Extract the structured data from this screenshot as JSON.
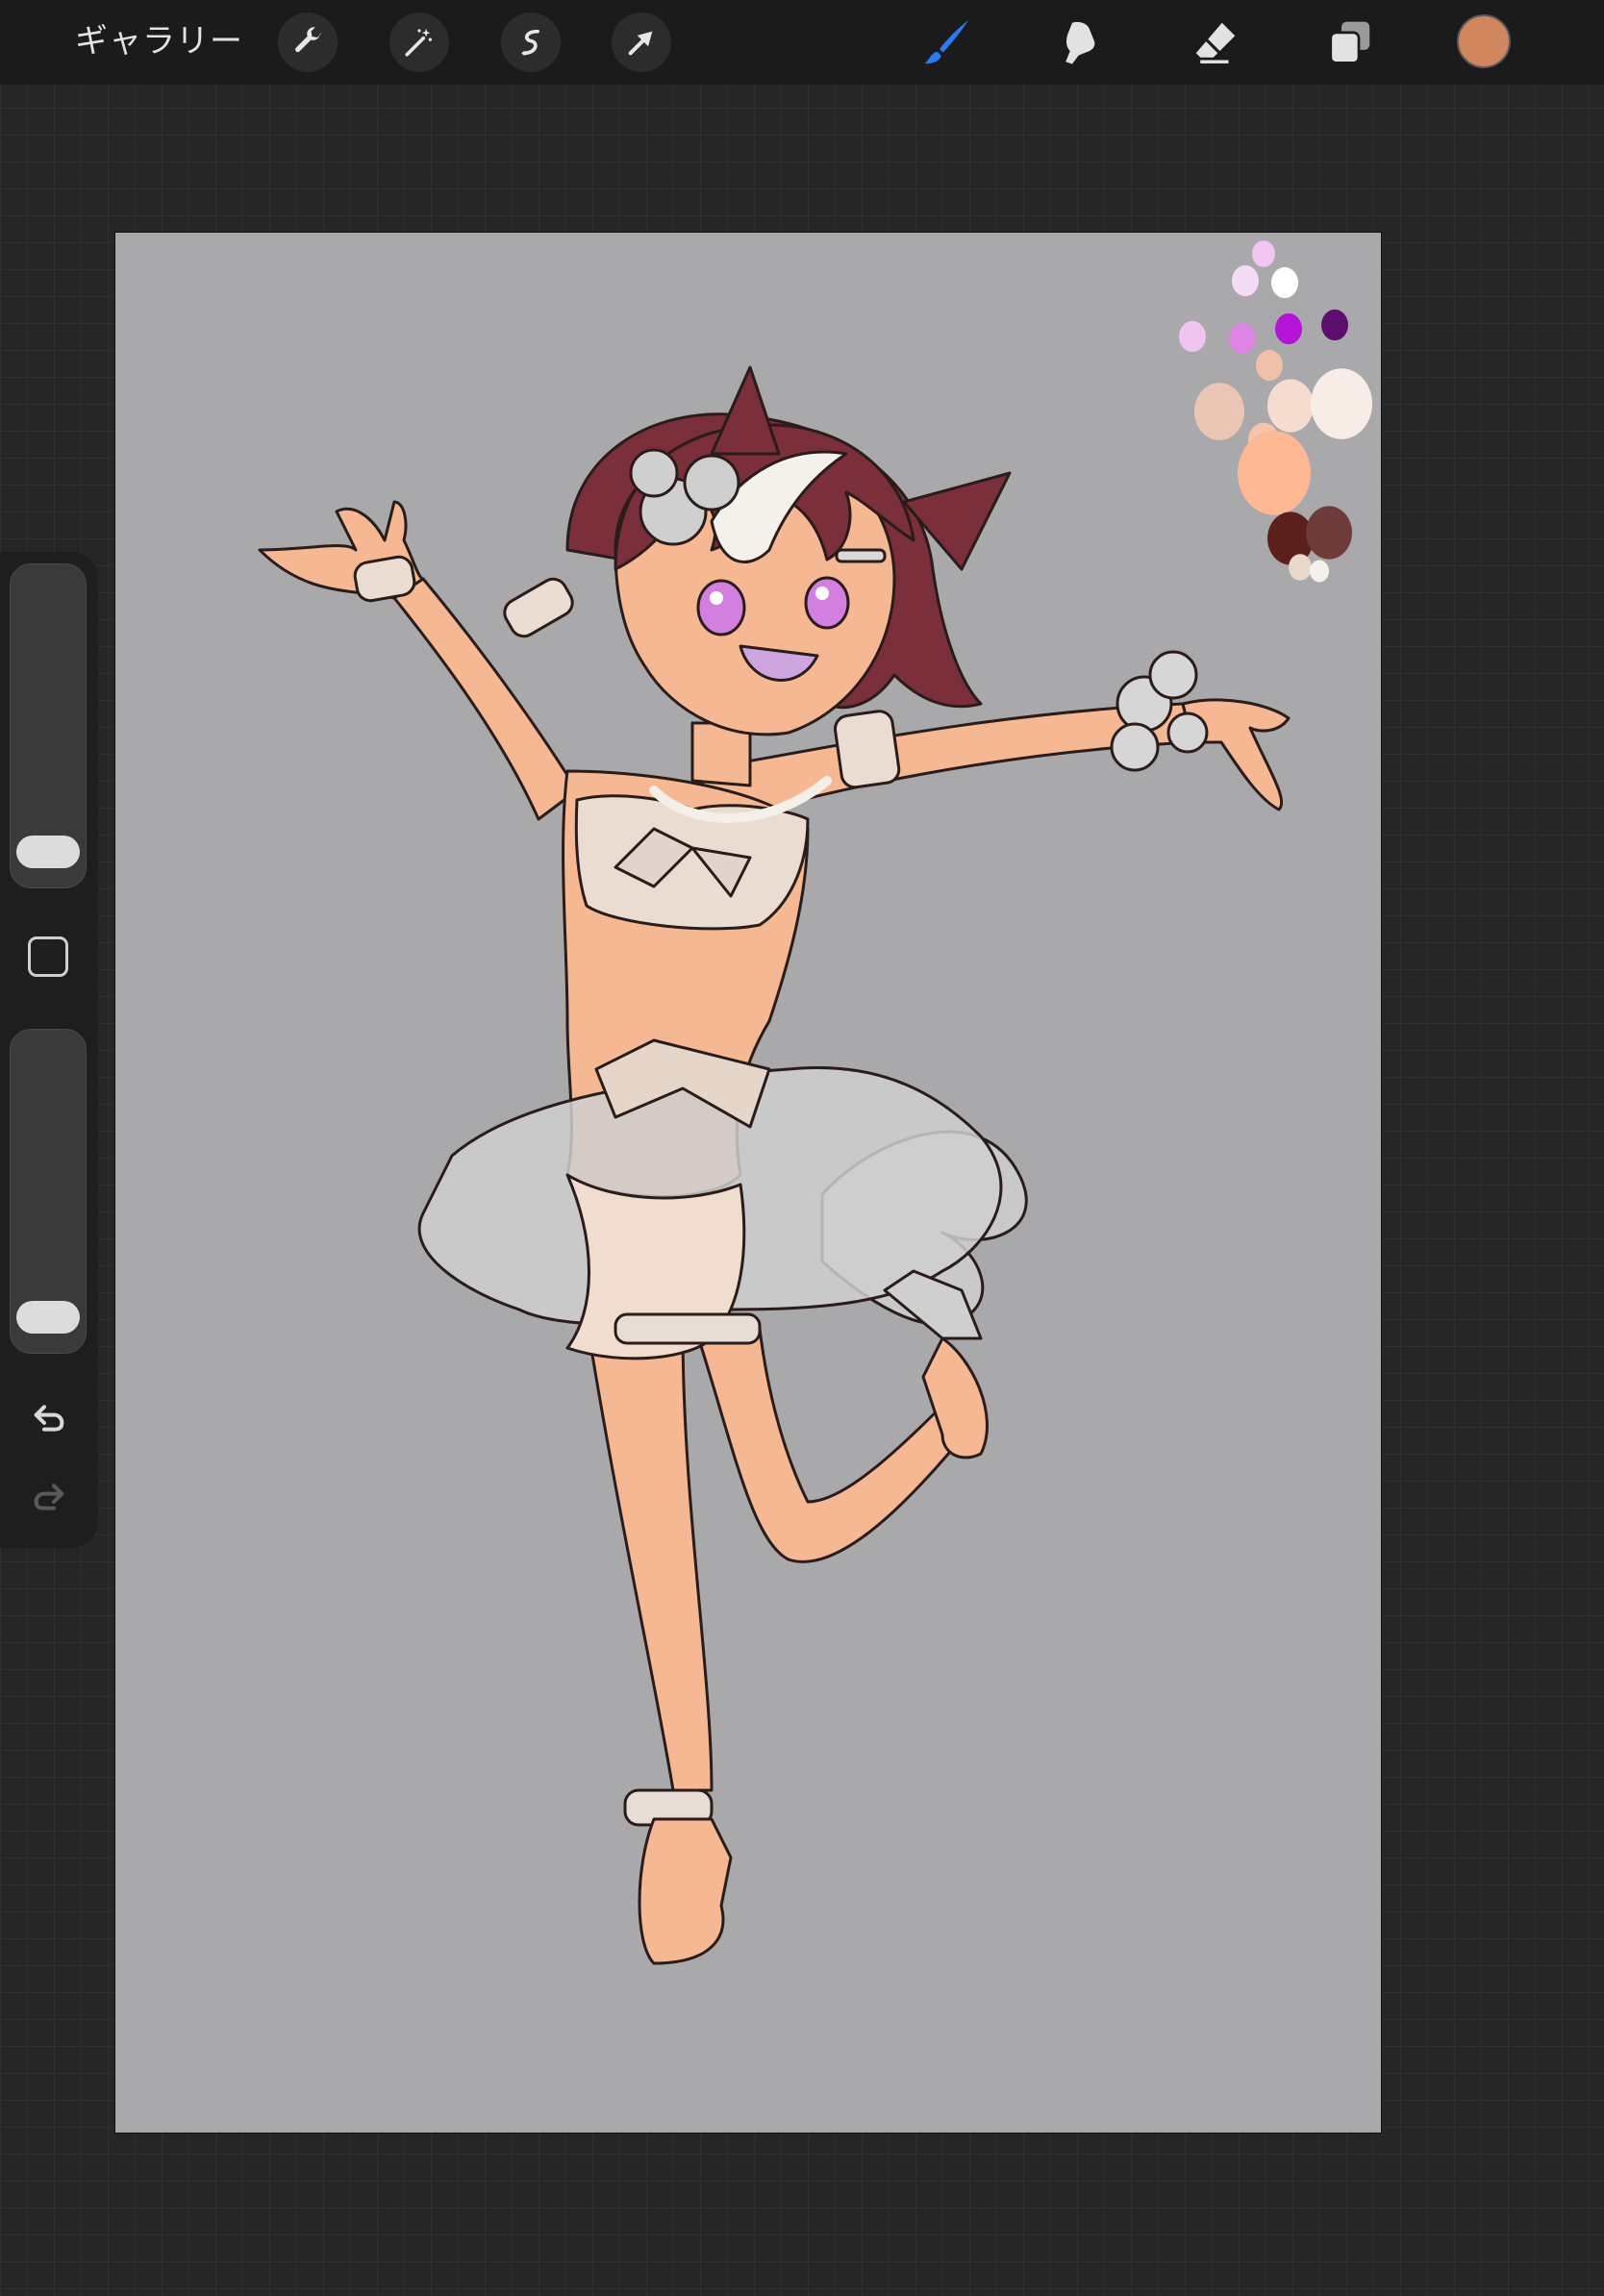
{
  "topbar": {
    "gallery_label": "ギャラリー",
    "actions": [
      {
        "name": "actions",
        "icon": "wrench-icon"
      },
      {
        "name": "adjustments",
        "icon": "magic-wand-icon"
      },
      {
        "name": "selection",
        "icon": "selection-s-icon"
      },
      {
        "name": "transform",
        "icon": "arrow-cursor-icon"
      }
    ],
    "tools": [
      {
        "name": "brush",
        "icon": "brush-icon",
        "active": true,
        "color": "#2d7bf4"
      },
      {
        "name": "smudge",
        "icon": "smudge-finger-icon",
        "active": false
      },
      {
        "name": "eraser",
        "icon": "eraser-icon",
        "active": false
      },
      {
        "name": "layers",
        "icon": "layers-icon",
        "active": false
      }
    ],
    "current_color": "#d2865e"
  },
  "sidebar": {
    "brush_size_level": 0.05,
    "opacity_level": 0.05,
    "icons": [
      "square-modifier-icon",
      "undo-icon",
      "redo-icon"
    ]
  },
  "canvas": {
    "background_color": "#a9a9ab",
    "palette_swatches": [
      "#f1c6f2",
      "#f4dbf6",
      "#ffffff",
      "#f0c3f0",
      "#de85e6",
      "#b514d8",
      "#5e0e6c",
      "#f0c0a8",
      "#ecc6b4",
      "#f6dccf",
      "#f8ece6",
      "#f6c4aa",
      "#ffb894",
      "#5b1f1c",
      "#6f3a3a",
      "#e8d8cc",
      "#f4f0ea"
    ]
  }
}
